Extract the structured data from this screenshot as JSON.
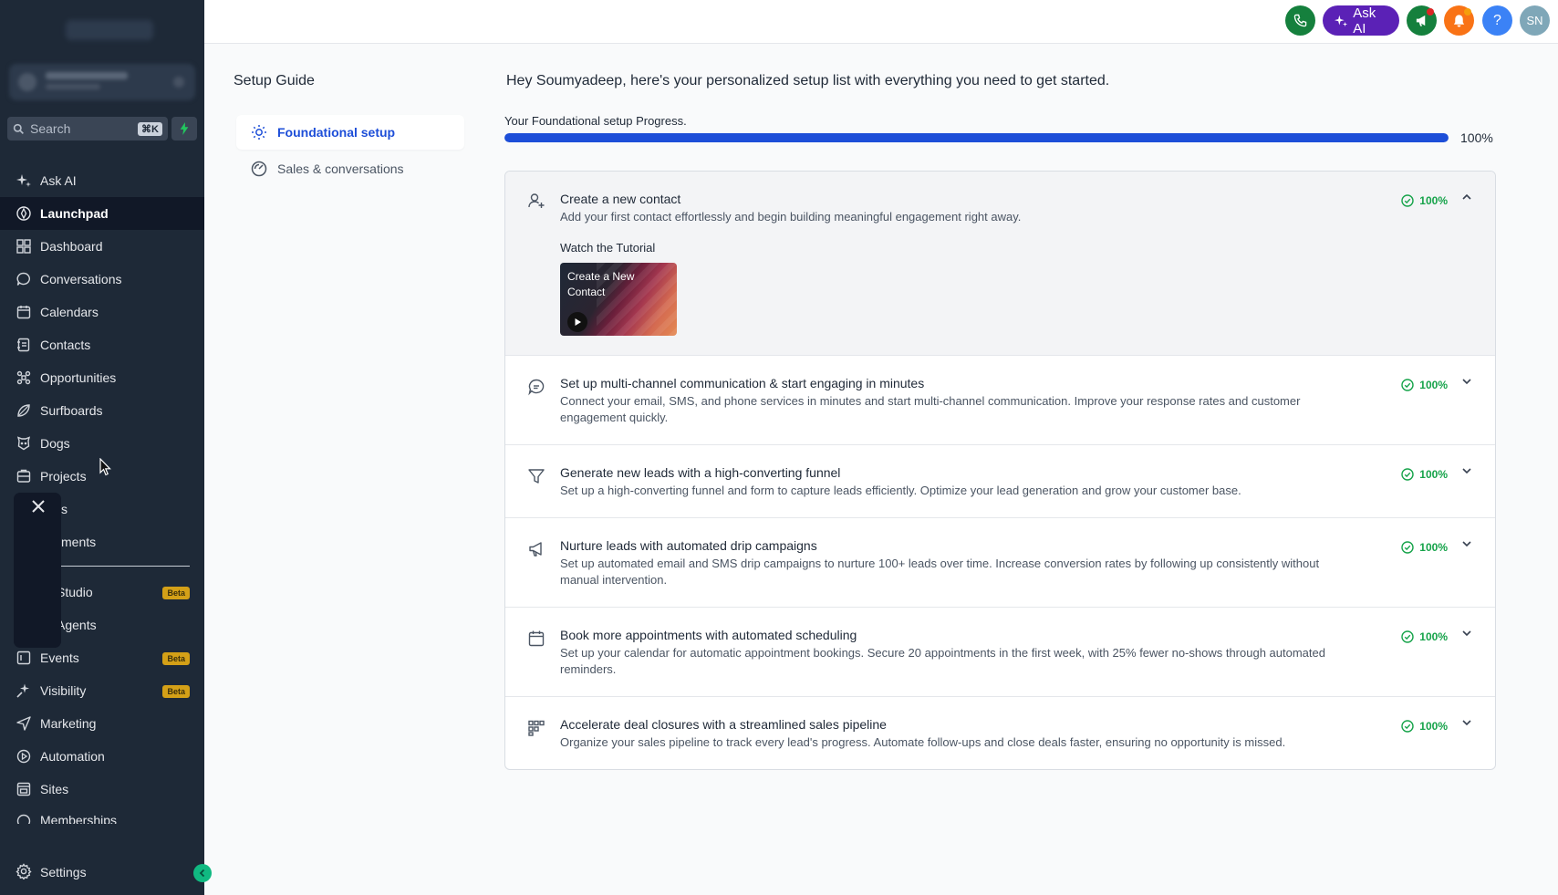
{
  "sidebar": {
    "search": {
      "placeholder": "Search",
      "shortcut": "⌘K"
    },
    "items": [
      {
        "label": "Ask AI",
        "icon": "sparkle-icon"
      },
      {
        "label": "Launchpad",
        "icon": "rocket-icon",
        "active": true
      },
      {
        "label": "Dashboard",
        "icon": "grid-icon"
      },
      {
        "label": "Conversations",
        "icon": "chat-icon"
      },
      {
        "label": "Calendars",
        "icon": "calendar-icon"
      },
      {
        "label": "Contacts",
        "icon": "contacts-icon"
      },
      {
        "label": "Opportunities",
        "icon": "opportunities-icon"
      },
      {
        "label": "Surfboards",
        "icon": "surfboard-icon"
      },
      {
        "label": "Dogs",
        "icon": "dog-icon"
      },
      {
        "label": "Projects",
        "icon": "projects-icon"
      },
      {
        "label": "s",
        "icon": "none"
      },
      {
        "label": "ments",
        "icon": "none"
      },
      {
        "label": "Studio",
        "icon": "none",
        "badge": "Beta"
      },
      {
        "label": "Agents",
        "icon": "none"
      },
      {
        "label": "Events",
        "icon": "events-icon",
        "badge": "Beta"
      },
      {
        "label": "Visibility",
        "icon": "visibility-icon",
        "badge": "Beta"
      },
      {
        "label": "Marketing",
        "icon": "send-icon"
      },
      {
        "label": "Automation",
        "icon": "automation-icon"
      },
      {
        "label": "Sites",
        "icon": "sites-icon"
      },
      {
        "label": "Memberships",
        "icon": "membership-icon"
      }
    ],
    "settings_label": "Settings"
  },
  "topbar": {
    "ask_ai_label": "Ask AI",
    "avatar_initials": "SN",
    "help_label": "?"
  },
  "main": {
    "guide_title": "Setup Guide",
    "guide_sections": [
      {
        "label": "Foundational setup",
        "active": true
      },
      {
        "label": "Sales & conversations",
        "active": false
      }
    ],
    "greeting": "Hey Soumyadeep, here's your personalized setup list with everything you need to get started.",
    "progress_label": "Your Foundational setup Progress.",
    "progress_percent": "100%",
    "progress_value": 1.0,
    "watch_label": "Watch the Tutorial",
    "video_title": "Create a New Contact",
    "tasks": [
      {
        "title": "Create a new contact",
        "desc": "Add your first contact effortlessly and begin building meaningful engagement right away.",
        "status": "100%",
        "expanded": true
      },
      {
        "title": "Set up multi-channel communication & start engaging in minutes",
        "desc": "Connect your email, SMS, and phone services in minutes and start multi-channel communication. Improve your response rates and customer engagement quickly.",
        "status": "100%"
      },
      {
        "title": "Generate new leads with a high-converting funnel",
        "desc": "Set up a high-converting funnel and form to capture leads efficiently. Optimize your lead generation and grow your customer base.",
        "status": "100%"
      },
      {
        "title": "Nurture leads with automated drip campaigns",
        "desc": "Set up automated email and SMS drip campaigns to nurture 100+ leads over time. Increase conversion rates by following up consistently without manual intervention.",
        "status": "100%"
      },
      {
        "title": "Book more appointments with automated scheduling",
        "desc": "Set up your calendar for automatic appointment bookings. Secure 20 appointments in the first week, with 25% fewer no-shows through automated reminders.",
        "status": "100%"
      },
      {
        "title": "Accelerate deal closures with a streamlined sales pipeline",
        "desc": "Organize your sales pipeline to track every lead's progress. Automate follow-ups and close deals faster, ensuring no opportunity is missed.",
        "status": "100%"
      }
    ]
  },
  "colors": {
    "sidebar_bg": "#1e2937",
    "accent_blue": "#1d4ed8",
    "success_green": "#16a34a",
    "ask_ai_purple": "#5b21b6",
    "beta_badge": "#d4a017"
  }
}
